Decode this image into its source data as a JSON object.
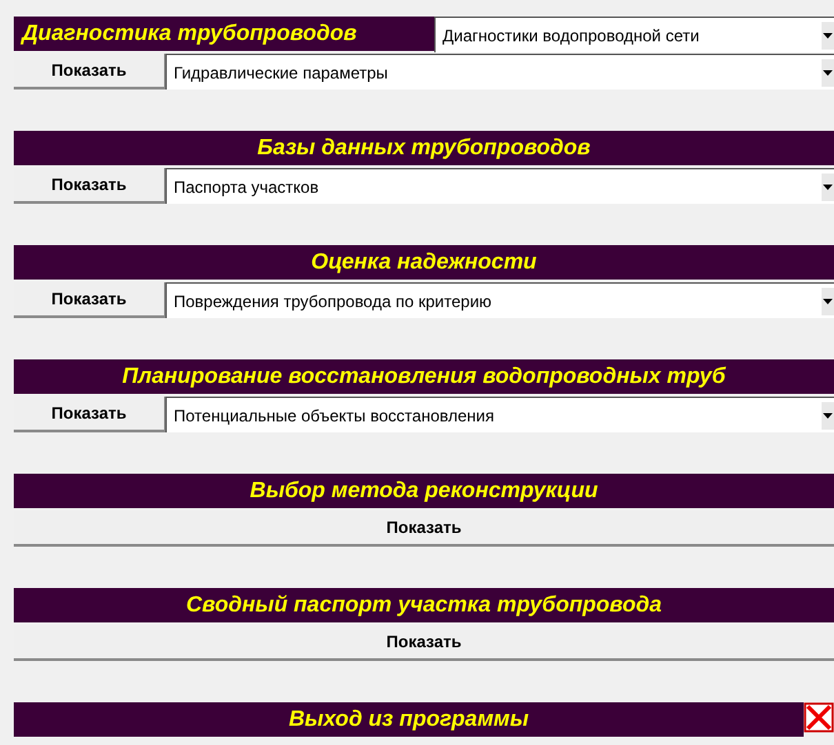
{
  "sections": [
    {
      "kind": "combo",
      "title": "Диагностика трубопроводов",
      "header_select": "Диагностики водопроводной сети",
      "button": "Показать",
      "select": "Гидравлические параметры"
    },
    {
      "kind": "select",
      "title": "Базы данных трубопроводов",
      "button": "Показать",
      "select": "Паспорта участков"
    },
    {
      "kind": "select",
      "title": "Оценка надежности",
      "button": "Показать",
      "select": "Повреждения трубопровода по критерию"
    },
    {
      "kind": "select",
      "title": "Планирование восстановления водопроводных труб",
      "button": "Показать",
      "select": "Потенциальные объекты восстановления"
    },
    {
      "kind": "button",
      "title": "Выбор метода реконструкции",
      "button": "Показать"
    },
    {
      "kind": "button",
      "title": "Сводный паспорт участка трубопровода",
      "button": "Показать"
    },
    {
      "kind": "exit",
      "title": "Выход из программы"
    }
  ]
}
